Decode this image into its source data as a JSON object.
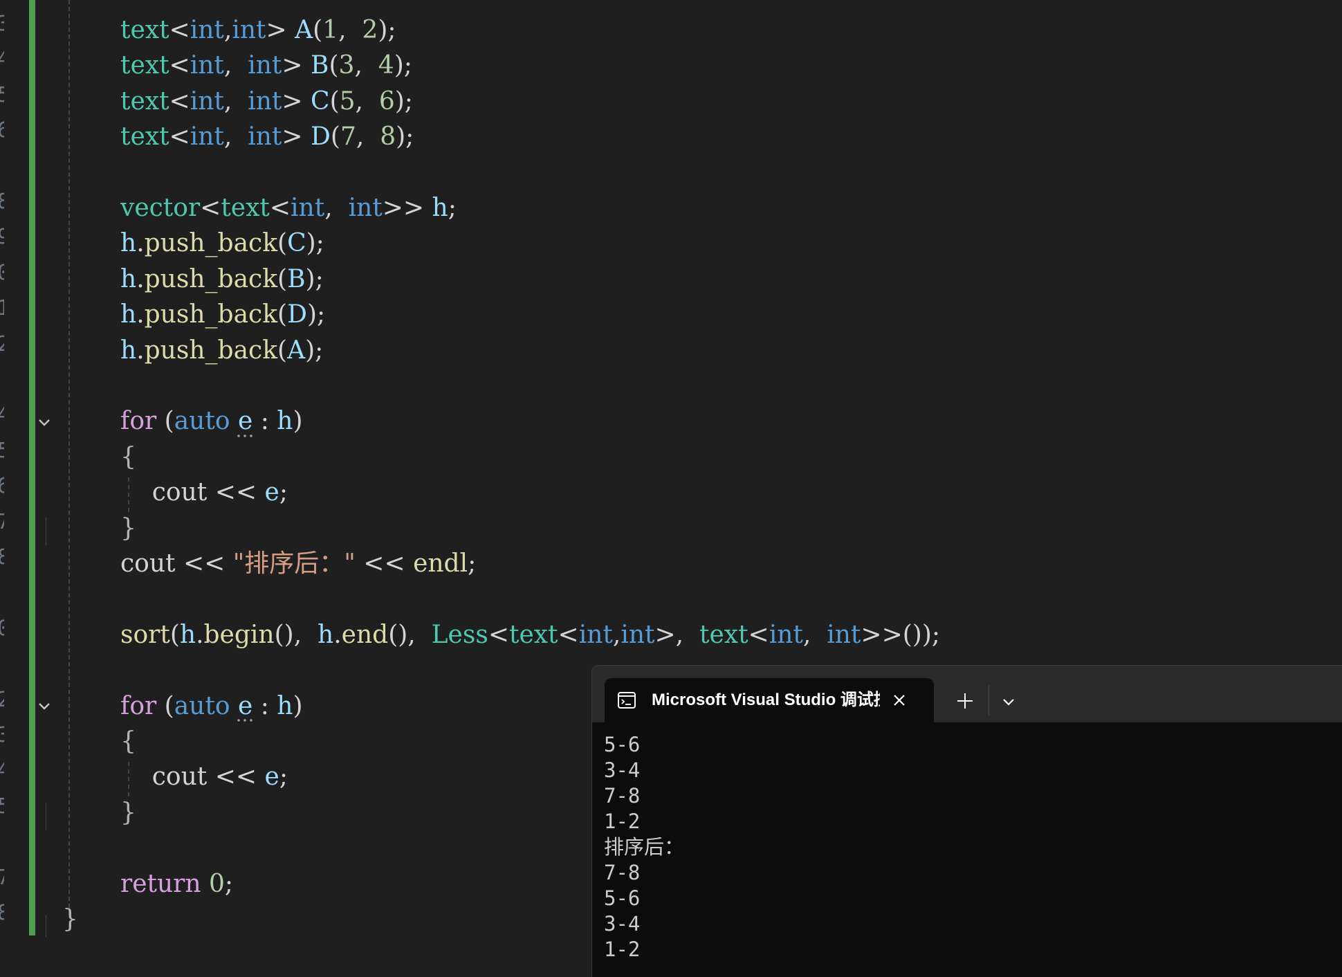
{
  "editor": {
    "line_numbers": [
      "3",
      "4",
      "5",
      "6",
      "",
      "8",
      "9",
      "0",
      "1",
      "2",
      "",
      "4",
      "5",
      "6",
      "7",
      "8",
      "",
      "0",
      "",
      "2",
      "3",
      "4",
      "5",
      "",
      "7",
      "8"
    ],
    "lines": [
      [
        {
          "c": "t-type",
          "t": "text"
        },
        {
          "c": "t-punc",
          "t": "<"
        },
        {
          "c": "t-kw",
          "t": "int"
        },
        {
          "c": "t-punc",
          "t": ","
        },
        {
          "c": "t-kw",
          "t": "int"
        },
        {
          "c": "t-punc",
          "t": "> "
        },
        {
          "c": "t-var",
          "t": "A"
        },
        {
          "c": "t-punc",
          "t": "("
        },
        {
          "c": "t-num",
          "t": "1"
        },
        {
          "c": "t-punc",
          "t": ",  "
        },
        {
          "c": "t-num",
          "t": "2"
        },
        {
          "c": "t-punc",
          "t": ");"
        }
      ],
      [
        {
          "c": "t-type",
          "t": "text"
        },
        {
          "c": "t-punc",
          "t": "<"
        },
        {
          "c": "t-kw",
          "t": "int"
        },
        {
          "c": "t-punc",
          "t": ",  "
        },
        {
          "c": "t-kw",
          "t": "int"
        },
        {
          "c": "t-punc",
          "t": "> "
        },
        {
          "c": "t-var",
          "t": "B"
        },
        {
          "c": "t-punc",
          "t": "("
        },
        {
          "c": "t-num",
          "t": "3"
        },
        {
          "c": "t-punc",
          "t": ",  "
        },
        {
          "c": "t-num",
          "t": "4"
        },
        {
          "c": "t-punc",
          "t": ");"
        }
      ],
      [
        {
          "c": "t-type",
          "t": "text"
        },
        {
          "c": "t-punc",
          "t": "<"
        },
        {
          "c": "t-kw",
          "t": "int"
        },
        {
          "c": "t-punc",
          "t": ",  "
        },
        {
          "c": "t-kw",
          "t": "int"
        },
        {
          "c": "t-punc",
          "t": "> "
        },
        {
          "c": "t-var",
          "t": "C"
        },
        {
          "c": "t-punc",
          "t": "("
        },
        {
          "c": "t-num",
          "t": "5"
        },
        {
          "c": "t-punc",
          "t": ",  "
        },
        {
          "c": "t-num",
          "t": "6"
        },
        {
          "c": "t-punc",
          "t": ");"
        }
      ],
      [
        {
          "c": "t-type",
          "t": "text"
        },
        {
          "c": "t-punc",
          "t": "<"
        },
        {
          "c": "t-kw",
          "t": "int"
        },
        {
          "c": "t-punc",
          "t": ",  "
        },
        {
          "c": "t-kw",
          "t": "int"
        },
        {
          "c": "t-punc",
          "t": "> "
        },
        {
          "c": "t-var",
          "t": "D"
        },
        {
          "c": "t-punc",
          "t": "("
        },
        {
          "c": "t-num",
          "t": "7"
        },
        {
          "c": "t-punc",
          "t": ",  "
        },
        {
          "c": "t-num",
          "t": "8"
        },
        {
          "c": "t-punc",
          "t": ");"
        }
      ],
      [],
      [
        {
          "c": "t-type",
          "t": "vector"
        },
        {
          "c": "t-punc",
          "t": "<"
        },
        {
          "c": "t-type",
          "t": "text"
        },
        {
          "c": "t-punc",
          "t": "<"
        },
        {
          "c": "t-kw",
          "t": "int"
        },
        {
          "c": "t-punc",
          "t": ",  "
        },
        {
          "c": "t-kw",
          "t": "int"
        },
        {
          "c": "t-punc",
          "t": ">> "
        },
        {
          "c": "t-var",
          "t": "h"
        },
        {
          "c": "t-punc",
          "t": ";"
        }
      ],
      [
        {
          "c": "t-var",
          "t": "h"
        },
        {
          "c": "t-punc",
          "t": "."
        },
        {
          "c": "t-fn",
          "t": "push_back"
        },
        {
          "c": "t-punc",
          "t": "("
        },
        {
          "c": "t-var",
          "t": "C"
        },
        {
          "c": "t-punc",
          "t": ");"
        }
      ],
      [
        {
          "c": "t-var",
          "t": "h"
        },
        {
          "c": "t-punc",
          "t": "."
        },
        {
          "c": "t-fn",
          "t": "push_back"
        },
        {
          "c": "t-punc",
          "t": "("
        },
        {
          "c": "t-var",
          "t": "B"
        },
        {
          "c": "t-punc",
          "t": ");"
        }
      ],
      [
        {
          "c": "t-var",
          "t": "h"
        },
        {
          "c": "t-punc",
          "t": "."
        },
        {
          "c": "t-fn",
          "t": "push_back"
        },
        {
          "c": "t-punc",
          "t": "("
        },
        {
          "c": "t-var",
          "t": "D"
        },
        {
          "c": "t-punc",
          "t": ");"
        }
      ],
      [
        {
          "c": "t-var",
          "t": "h"
        },
        {
          "c": "t-punc",
          "t": "."
        },
        {
          "c": "t-fn",
          "t": "push_back"
        },
        {
          "c": "t-punc",
          "t": "("
        },
        {
          "c": "t-var",
          "t": "A"
        },
        {
          "c": "t-punc",
          "t": ");"
        }
      ],
      [],
      [
        {
          "c": "t-ctl",
          "t": "for"
        },
        {
          "c": "t-punc",
          "t": " ("
        },
        {
          "c": "t-kw",
          "t": "auto"
        },
        {
          "c": "t-punc",
          "t": " "
        },
        {
          "c": "t-var squig",
          "t": "e"
        },
        {
          "c": "t-punc",
          "t": " : "
        },
        {
          "c": "t-var",
          "t": "h"
        },
        {
          "c": "t-punc",
          "t": ")"
        }
      ],
      [
        {
          "c": "t-brace",
          "t": "{"
        }
      ],
      [
        {
          "c": "t-punc",
          "t": "    cout "
        },
        {
          "c": "t-punc",
          "t": "<< "
        },
        {
          "c": "t-var",
          "t": "e"
        },
        {
          "c": "t-punc",
          "t": ";"
        }
      ],
      [
        {
          "c": "t-brace",
          "t": "}"
        }
      ],
      [
        {
          "c": "t-punc",
          "t": "cout "
        },
        {
          "c": "t-punc",
          "t": "<< "
        },
        {
          "c": "t-str",
          "t": "\"排序后：\""
        },
        {
          "c": "t-punc",
          "t": " << "
        },
        {
          "c": "t-fn",
          "t": "endl"
        },
        {
          "c": "t-punc",
          "t": ";"
        }
      ],
      [],
      [
        {
          "c": "t-fn",
          "t": "sort"
        },
        {
          "c": "t-punc",
          "t": "("
        },
        {
          "c": "t-var",
          "t": "h"
        },
        {
          "c": "t-punc",
          "t": "."
        },
        {
          "c": "t-fn",
          "t": "begin"
        },
        {
          "c": "t-punc",
          "t": "(),  "
        },
        {
          "c": "t-var",
          "t": "h"
        },
        {
          "c": "t-punc",
          "t": "."
        },
        {
          "c": "t-fn",
          "t": "end"
        },
        {
          "c": "t-punc",
          "t": "(),  "
        },
        {
          "c": "t-type",
          "t": "Less"
        },
        {
          "c": "t-punc",
          "t": "<"
        },
        {
          "c": "t-type",
          "t": "text"
        },
        {
          "c": "t-punc",
          "t": "<"
        },
        {
          "c": "t-kw",
          "t": "int"
        },
        {
          "c": "t-punc",
          "t": ","
        },
        {
          "c": "t-kw",
          "t": "int"
        },
        {
          "c": "t-punc",
          "t": ">,  "
        },
        {
          "c": "t-type",
          "t": "text"
        },
        {
          "c": "t-punc",
          "t": "<"
        },
        {
          "c": "t-kw",
          "t": "int"
        },
        {
          "c": "t-punc",
          "t": ",  "
        },
        {
          "c": "t-kw",
          "t": "int"
        },
        {
          "c": "t-punc",
          "t": ">>());"
        }
      ],
      [],
      [
        {
          "c": "t-ctl",
          "t": "for"
        },
        {
          "c": "t-punc",
          "t": " ("
        },
        {
          "c": "t-kw",
          "t": "auto"
        },
        {
          "c": "t-punc",
          "t": " "
        },
        {
          "c": "t-var squig",
          "t": "e"
        },
        {
          "c": "t-punc",
          "t": " : "
        },
        {
          "c": "t-var",
          "t": "h"
        },
        {
          "c": "t-punc",
          "t": ")"
        }
      ],
      [
        {
          "c": "t-brace",
          "t": "{"
        }
      ],
      [
        {
          "c": "t-punc",
          "t": "    cout "
        },
        {
          "c": "t-punc",
          "t": "<< "
        },
        {
          "c": "t-var",
          "t": "e"
        },
        {
          "c": "t-punc",
          "t": ";"
        }
      ],
      [
        {
          "c": "t-brace",
          "t": "}"
        }
      ],
      [],
      [
        {
          "c": "t-ctl",
          "t": "return"
        },
        {
          "c": "t-punc",
          "t": " "
        },
        {
          "c": "t-num",
          "t": "0"
        },
        {
          "c": "t-punc",
          "t": ";"
        }
      ],
      [
        {
          "c": "t-brace",
          "t": "}"
        }
      ]
    ]
  },
  "terminal": {
    "tab_title": "Microsoft Visual Studio 调试控制台",
    "output_lines": [
      "5-6",
      "3-4",
      "7-8",
      "1-2",
      "排序后：",
      "7-8",
      "5-6",
      "3-4",
      "1-2"
    ]
  },
  "icons": {
    "tab_icon": "console-icon",
    "close": "close-icon",
    "new_tab": "plus-icon",
    "dropdown": "chevron-down-icon",
    "fold": "fold-chevron-icon"
  },
  "colors": {
    "editor_bg": "#1f1f1f",
    "change_bar": "#4d9e4f",
    "type": "#4ec9b0",
    "keyword": "#569cd6",
    "control": "#d8a0df",
    "variable": "#9cdcfe",
    "function": "#dcdcaa",
    "number": "#b5cea8",
    "string": "#d69d85",
    "terminal_bg": "#0c0c0c"
  }
}
